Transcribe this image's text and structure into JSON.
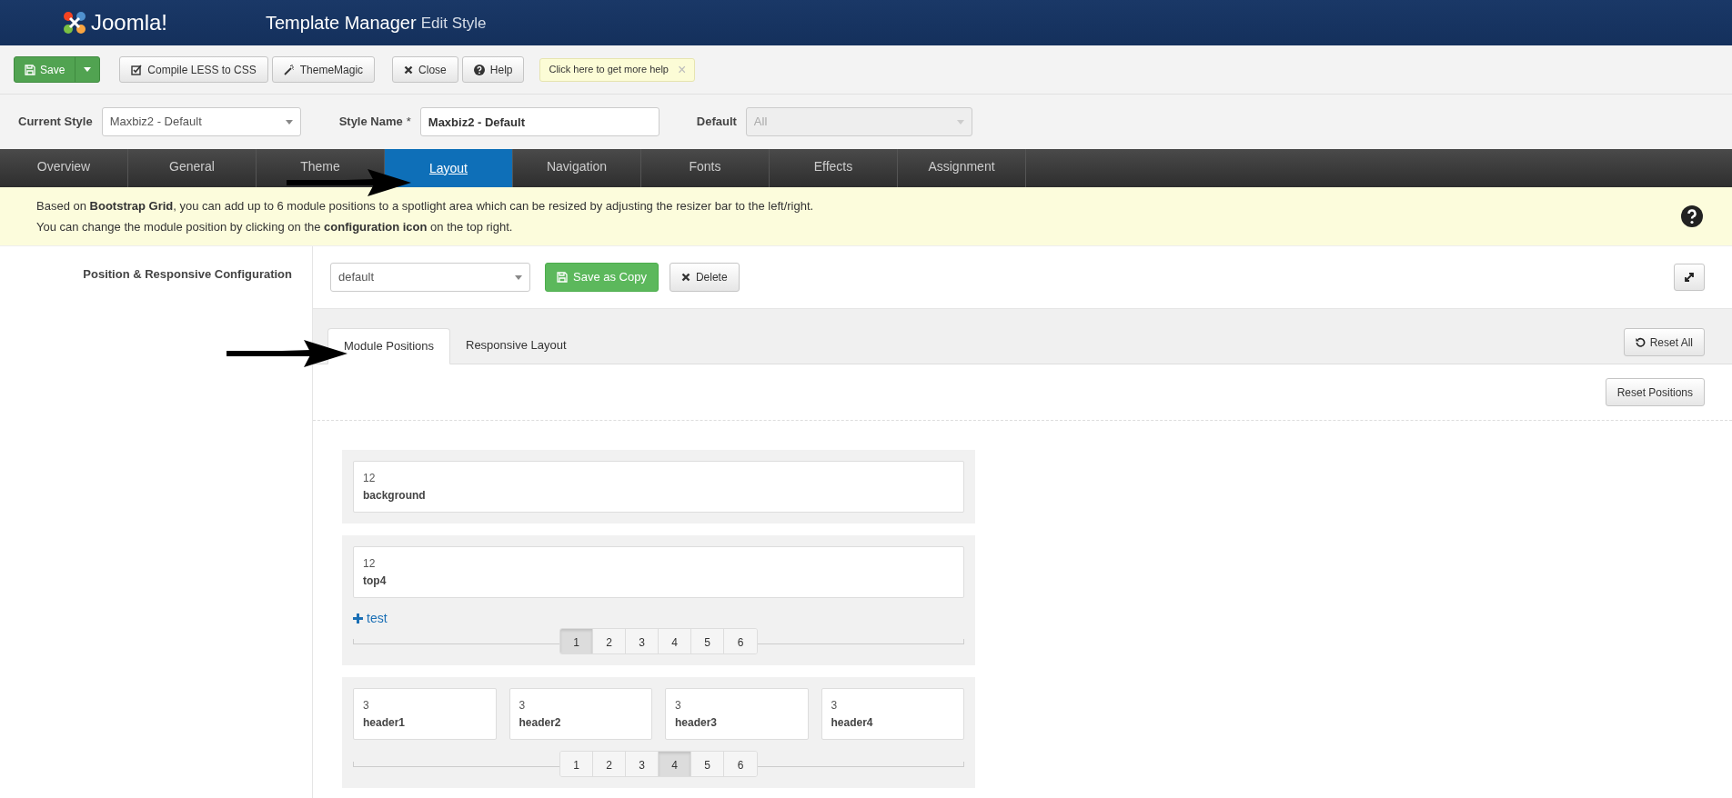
{
  "header": {
    "logo_text": "Joomla!",
    "title": "Template Manager",
    "subtitle": "Edit Style"
  },
  "toolbar": {
    "buttons": [
      {
        "kind": "save",
        "label": "Save"
      },
      {
        "kind": "compile",
        "label": "Compile LESS to CSS"
      },
      {
        "kind": "magic",
        "label": "ThemeMagic"
      },
      {
        "kind": "close",
        "label": "Close"
      },
      {
        "kind": "help",
        "label": "Help"
      }
    ],
    "help_tip": {
      "text": "Click here to get more help",
      "close": "×"
    }
  },
  "style_row": {
    "current_style": {
      "label": "Current Style",
      "value": "Maxbiz2 - Default"
    },
    "style_name": {
      "label": "Style Name",
      "required": "*",
      "value": "Maxbiz2 - Default"
    },
    "default": {
      "label": "Default",
      "value": "All",
      "disabled": true
    }
  },
  "tabs": [
    {
      "label": "Overview",
      "selected": false
    },
    {
      "label": "General",
      "selected": false
    },
    {
      "label": "Theme",
      "selected": false
    },
    {
      "label": "Layout",
      "selected": true
    },
    {
      "label": "Navigation",
      "selected": false
    },
    {
      "label": "Fonts",
      "selected": false
    },
    {
      "label": "Effects",
      "selected": false
    },
    {
      "label": "Assignment",
      "selected": false
    }
  ],
  "notice": {
    "lines": [
      "Based on **Bootstrap Grid**, you can add up to 6 module positions to a spotlight area which can be resized by adjusting the resizer bar to the left/right.",
      "You can change the module position by clicking on the **configuration icon** on the top right."
    ]
  },
  "config": {
    "label": "Position & Responsive Configuration",
    "layout_select": "default",
    "save_copy": "Save as Copy",
    "delete": "Delete",
    "subtabs": [
      {
        "label": "Module Positions",
        "selected": true
      },
      {
        "label": "Responsive Layout",
        "selected": false
      }
    ],
    "reset_all": "Reset All",
    "reset_positions": "Reset Positions",
    "rows": [
      {
        "modules": [
          {
            "span": "12",
            "name": "background"
          }
        ]
      },
      {
        "modules": [
          {
            "span": "12",
            "name": "top4"
          }
        ],
        "add_link": "test",
        "pager": [
          {
            "label": "1",
            "selected": true
          },
          {
            "label": "2",
            "selected": false
          },
          {
            "label": "3",
            "selected": false
          },
          {
            "label": "4",
            "selected": false
          },
          {
            "label": "5",
            "selected": false
          },
          {
            "label": "6",
            "selected": false
          }
        ]
      },
      {
        "modules": [
          {
            "span": "3",
            "name": "header1"
          },
          {
            "span": "3",
            "name": "header2"
          },
          {
            "span": "3",
            "name": "header3"
          },
          {
            "span": "3",
            "name": "header4"
          }
        ],
        "pager": [
          {
            "label": "1",
            "selected": false
          },
          {
            "label": "2",
            "selected": false
          },
          {
            "label": "3",
            "selected": false
          },
          {
            "label": "4",
            "selected": true
          },
          {
            "label": "5",
            "selected": false
          },
          {
            "label": "6",
            "selected": false
          }
        ]
      }
    ]
  }
}
